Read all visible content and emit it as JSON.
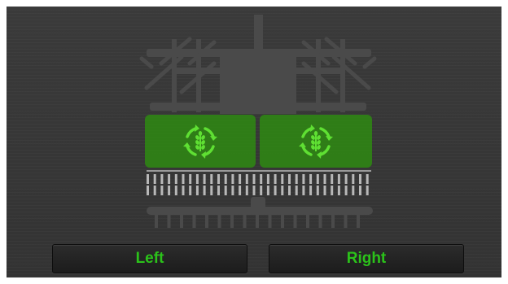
{
  "sections": [
    {
      "id": "left",
      "state": "active",
      "icon": "seed-rate-cycle-icon"
    },
    {
      "id": "right",
      "state": "active",
      "icon": "seed-rate-cycle-icon"
    }
  ],
  "buttons": {
    "left_label": "Left",
    "right_label": "Right"
  },
  "colors": {
    "accent_green": "#2bc21a",
    "section_active": "#2e8a12",
    "background": "#363636"
  }
}
